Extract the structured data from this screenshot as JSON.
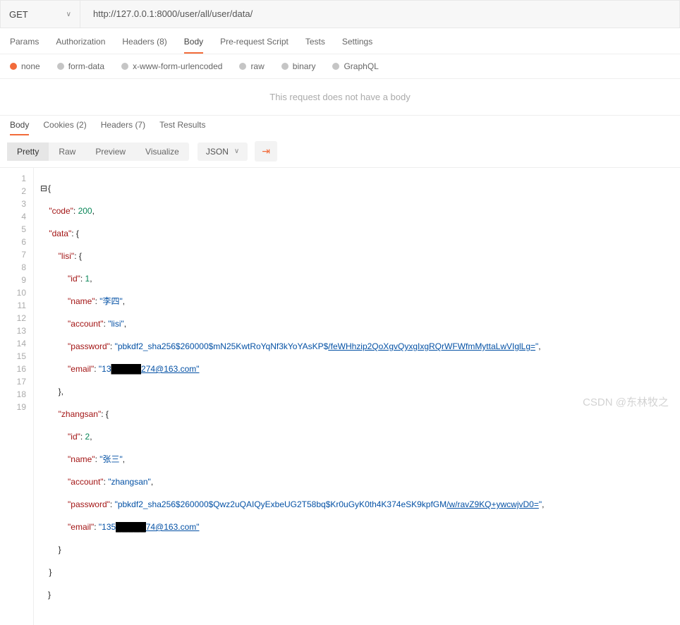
{
  "request": {
    "method": "GET",
    "url": "http://127.0.0.1:8000/user/all/user/data/"
  },
  "tabs1": {
    "params": "Params",
    "authorization": "Authorization",
    "headers": "Headers",
    "headers_count": "(8)",
    "body": "Body",
    "pre": "Pre-request Script",
    "tests": "Tests",
    "settings": "Settings"
  },
  "body_types": {
    "none": "none",
    "formdata": "form-data",
    "xwww": "x-www-form-urlencoded",
    "raw": "raw",
    "binary": "binary",
    "graphql": "GraphQL"
  },
  "nobody": "This request does not have a body",
  "resp_tabs": {
    "body": "Body",
    "cookies": "Cookies",
    "cookies_count": "(2)",
    "headers": "Headers",
    "headers_count": "(7)",
    "tests": "Test Results"
  },
  "view": {
    "pretty": "Pretty",
    "raw": "Raw",
    "preview": "Preview",
    "visualize": "Visualize",
    "format": "JSON"
  },
  "json": {
    "code_key": "\"code\"",
    "code_val": "200",
    "data_key": "\"data\"",
    "lisi_key": "\"lisi\"",
    "id_key": "\"id\"",
    "id1": "1",
    "name_key": "\"name\"",
    "name1": "\"李四\"",
    "account_key": "\"account\"",
    "account1": "\"lisi\"",
    "pw_key": "\"password\"",
    "pw1": "\"pbkdf2_sha256$260000$mN25KwtRoYqNf3kYoYAsKP$",
    "pw1u": "/feWHhzip2QoXgvQyxgIxgRQrWFWfmMyttaLwVIglLg=",
    "pw1end": "\"",
    "email_key": "\"email\"",
    "email1a": "\"13",
    "email_red": "█████",
    "email1b": "274@163.com\"",
    "zhangsan_key": "\"zhangsan\"",
    "id2": "2",
    "name2": "\"张三\"",
    "account2": "\"zhangsan\"",
    "pw2": "\"pbkdf2_sha256$260000$Qwz2uQAIQyExbeUG2T58bq$Kr0uGyK0th4K374eSK9kpfGM",
    "pw2u": "/w/ravZ9KQ+ywcwjvD0=",
    "pw2end": "\"",
    "email2a": "\"135",
    "email2b": "74@163.com\""
  },
  "watermark": "CSDN @东林牧之"
}
